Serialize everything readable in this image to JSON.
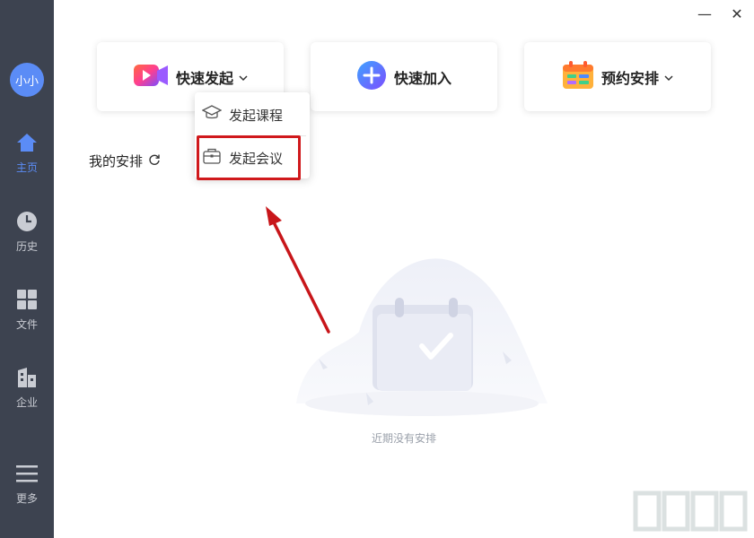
{
  "sidebar": {
    "avatar_text": "小小",
    "items": [
      {
        "label": "主页",
        "icon": "home-icon"
      },
      {
        "label": "历史",
        "icon": "clock-icon"
      },
      {
        "label": "文件",
        "icon": "grid-icon"
      },
      {
        "label": "企业",
        "icon": "building-icon"
      },
      {
        "label": "更多",
        "icon": "menu-icon"
      }
    ]
  },
  "window": {
    "minimize": "—",
    "close": "✕"
  },
  "cards": [
    {
      "label": "快速发起",
      "icon": "video-play-icon",
      "has_dropdown": true
    },
    {
      "label": "快速加入",
      "icon": "plus-circle-icon",
      "has_dropdown": false
    },
    {
      "label": "预约安排",
      "icon": "calendar-icon",
      "has_dropdown": true
    }
  ],
  "dropdown": {
    "items": [
      {
        "label": "发起课程",
        "icon": "graduation-cap-icon"
      },
      {
        "label": "发起会议",
        "icon": "briefcase-icon"
      }
    ]
  },
  "section": {
    "title": "我的安排"
  },
  "empty_state": {
    "text": "近期没有安排"
  },
  "colors": {
    "sidebar": "#3d4350",
    "accent": "#5b8cf6",
    "highlight": "#d0191c"
  }
}
